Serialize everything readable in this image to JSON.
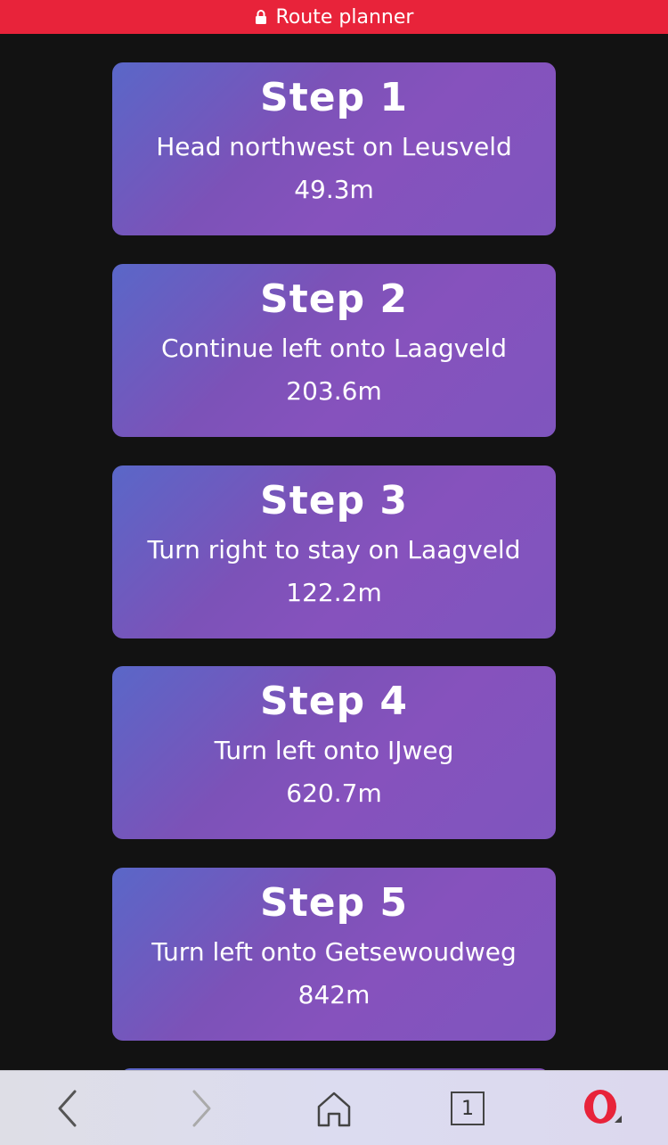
{
  "header": {
    "title": "Route planner",
    "color": "#e8233a"
  },
  "steps": [
    {
      "title": "Step 1",
      "instruction": "Head northwest on Leusveld",
      "distance": "49.3m"
    },
    {
      "title": "Step 2",
      "instruction": "Continue left onto Laagveld",
      "distance": "203.6m"
    },
    {
      "title": "Step 3",
      "instruction": "Turn right to stay on Laagveld",
      "distance": "122.2m"
    },
    {
      "title": "Step 4",
      "instruction": "Turn left onto IJweg",
      "distance": "620.7m"
    },
    {
      "title": "Step 5",
      "instruction": "Turn left onto Getsewoudweg",
      "distance": "842m"
    }
  ],
  "bottombar": {
    "tab_count": "1",
    "icons": [
      "back-icon",
      "forward-icon",
      "home-icon",
      "tabs-icon",
      "opera-menu-icon"
    ]
  }
}
